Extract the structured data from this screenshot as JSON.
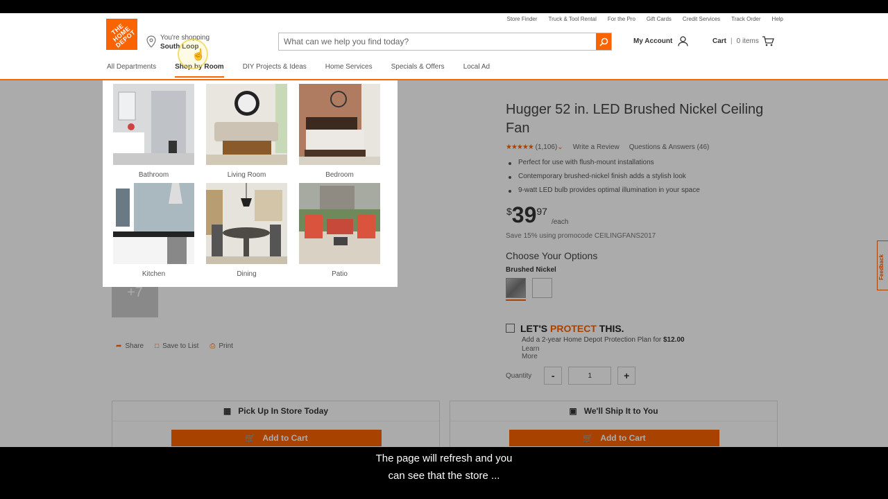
{
  "header": {
    "logo_text": "THE HOME DEPOT",
    "store": {
      "line1": "You're shopping",
      "name": "South Loop"
    },
    "utility_links": [
      "Store Finder",
      "Truck & Tool Rental",
      "For the Pro",
      "Gift Cards",
      "Credit Services",
      "Track Order",
      "Help"
    ],
    "search": {
      "placeholder": "What can we help you find today?"
    },
    "account": "My Account",
    "cart": {
      "label": "Cart",
      "items": "0 items"
    },
    "nav": [
      "All Departments",
      "Shop by Room",
      "DIY Projects & Ideas",
      "Home Services",
      "Specials & Offers",
      "Local Ad"
    ],
    "nav_active_index": 1
  },
  "dropdown": {
    "rooms": [
      "Bathroom",
      "Living Room",
      "Bedroom",
      "Kitchen",
      "Dining",
      "Patio"
    ]
  },
  "product": {
    "title": "Hugger 52 in. LED Brushed Nickel Ceiling Fan",
    "rating_stars": 4.5,
    "review_count": "(1,106)",
    "write_review": "Write a Review",
    "qa": "Questions & Answers (46)",
    "bullets": [
      "Perfect for use with flush-mount installations",
      "Contemporary brushed-nickel finish adds a stylish look",
      "9-watt LED bulb provides optimal illumination in your space"
    ],
    "price": {
      "currency": "$",
      "dollars": "39",
      "cents": "97",
      "unit": "/each"
    },
    "promo": "Save 15% using promocode CEILINGFANS2017",
    "choose": "Choose Your Options",
    "finish": "Brushed Nickel",
    "thumb_more": "+7",
    "share": [
      "Share",
      "Save to List",
      "Print"
    ],
    "protect": {
      "head_a": "LET'S ",
      "head_b": "PROTECT",
      "head_c": " THIS.",
      "desc": "Add a 2-year Home Depot Protection Plan for ",
      "price": "$12.00",
      "more": "Learn More"
    },
    "quantity": {
      "label": "Quantity",
      "minus": "-",
      "value": "1",
      "plus": "+"
    },
    "pickup": {
      "title": "Pick Up In Store Today",
      "button": "Add to Cart"
    },
    "ship": {
      "title": "We'll Ship It to You",
      "button": "Add to Cart"
    }
  },
  "feedback_tab": "Feedback",
  "caption": {
    "line1": "The page will refresh and you",
    "line2": "can see that the store ..."
  },
  "colors": {
    "brand_orange": "#f96302"
  }
}
